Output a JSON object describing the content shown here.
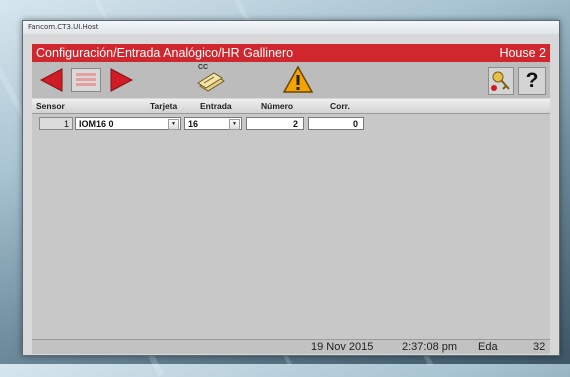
{
  "window": {
    "title": "Fancom.CT3.UI.Host"
  },
  "header": {
    "title": "Configuración/Entrada Analógico/HR Gallinero",
    "house": "House 2"
  },
  "toolbar": {
    "cc_label": "CC",
    "help_glyph": "?",
    "icons": [
      "arrow-left-icon",
      "grid-icon",
      "arrow-right-icon",
      "copy-card-icon",
      "warning-icon",
      "key-icon",
      "help-icon"
    ],
    "colors": {
      "arrow": "#d01c24",
      "warning": "#f2a400",
      "header": "#d0272f"
    }
  },
  "table": {
    "columns": {
      "sensor": "Sensor",
      "tarjeta": "Tarjeta",
      "entrada": "Entrada",
      "numero": "Número",
      "corr": "Corr."
    },
    "rows": [
      {
        "index": "1",
        "tarjeta": "IOM16 0",
        "entrada": "16",
        "numero": "2",
        "corr": "0"
      }
    ]
  },
  "status": {
    "date": "19 Nov 2015",
    "time": "2:37:08 pm",
    "label": "Eda",
    "value": "32"
  }
}
